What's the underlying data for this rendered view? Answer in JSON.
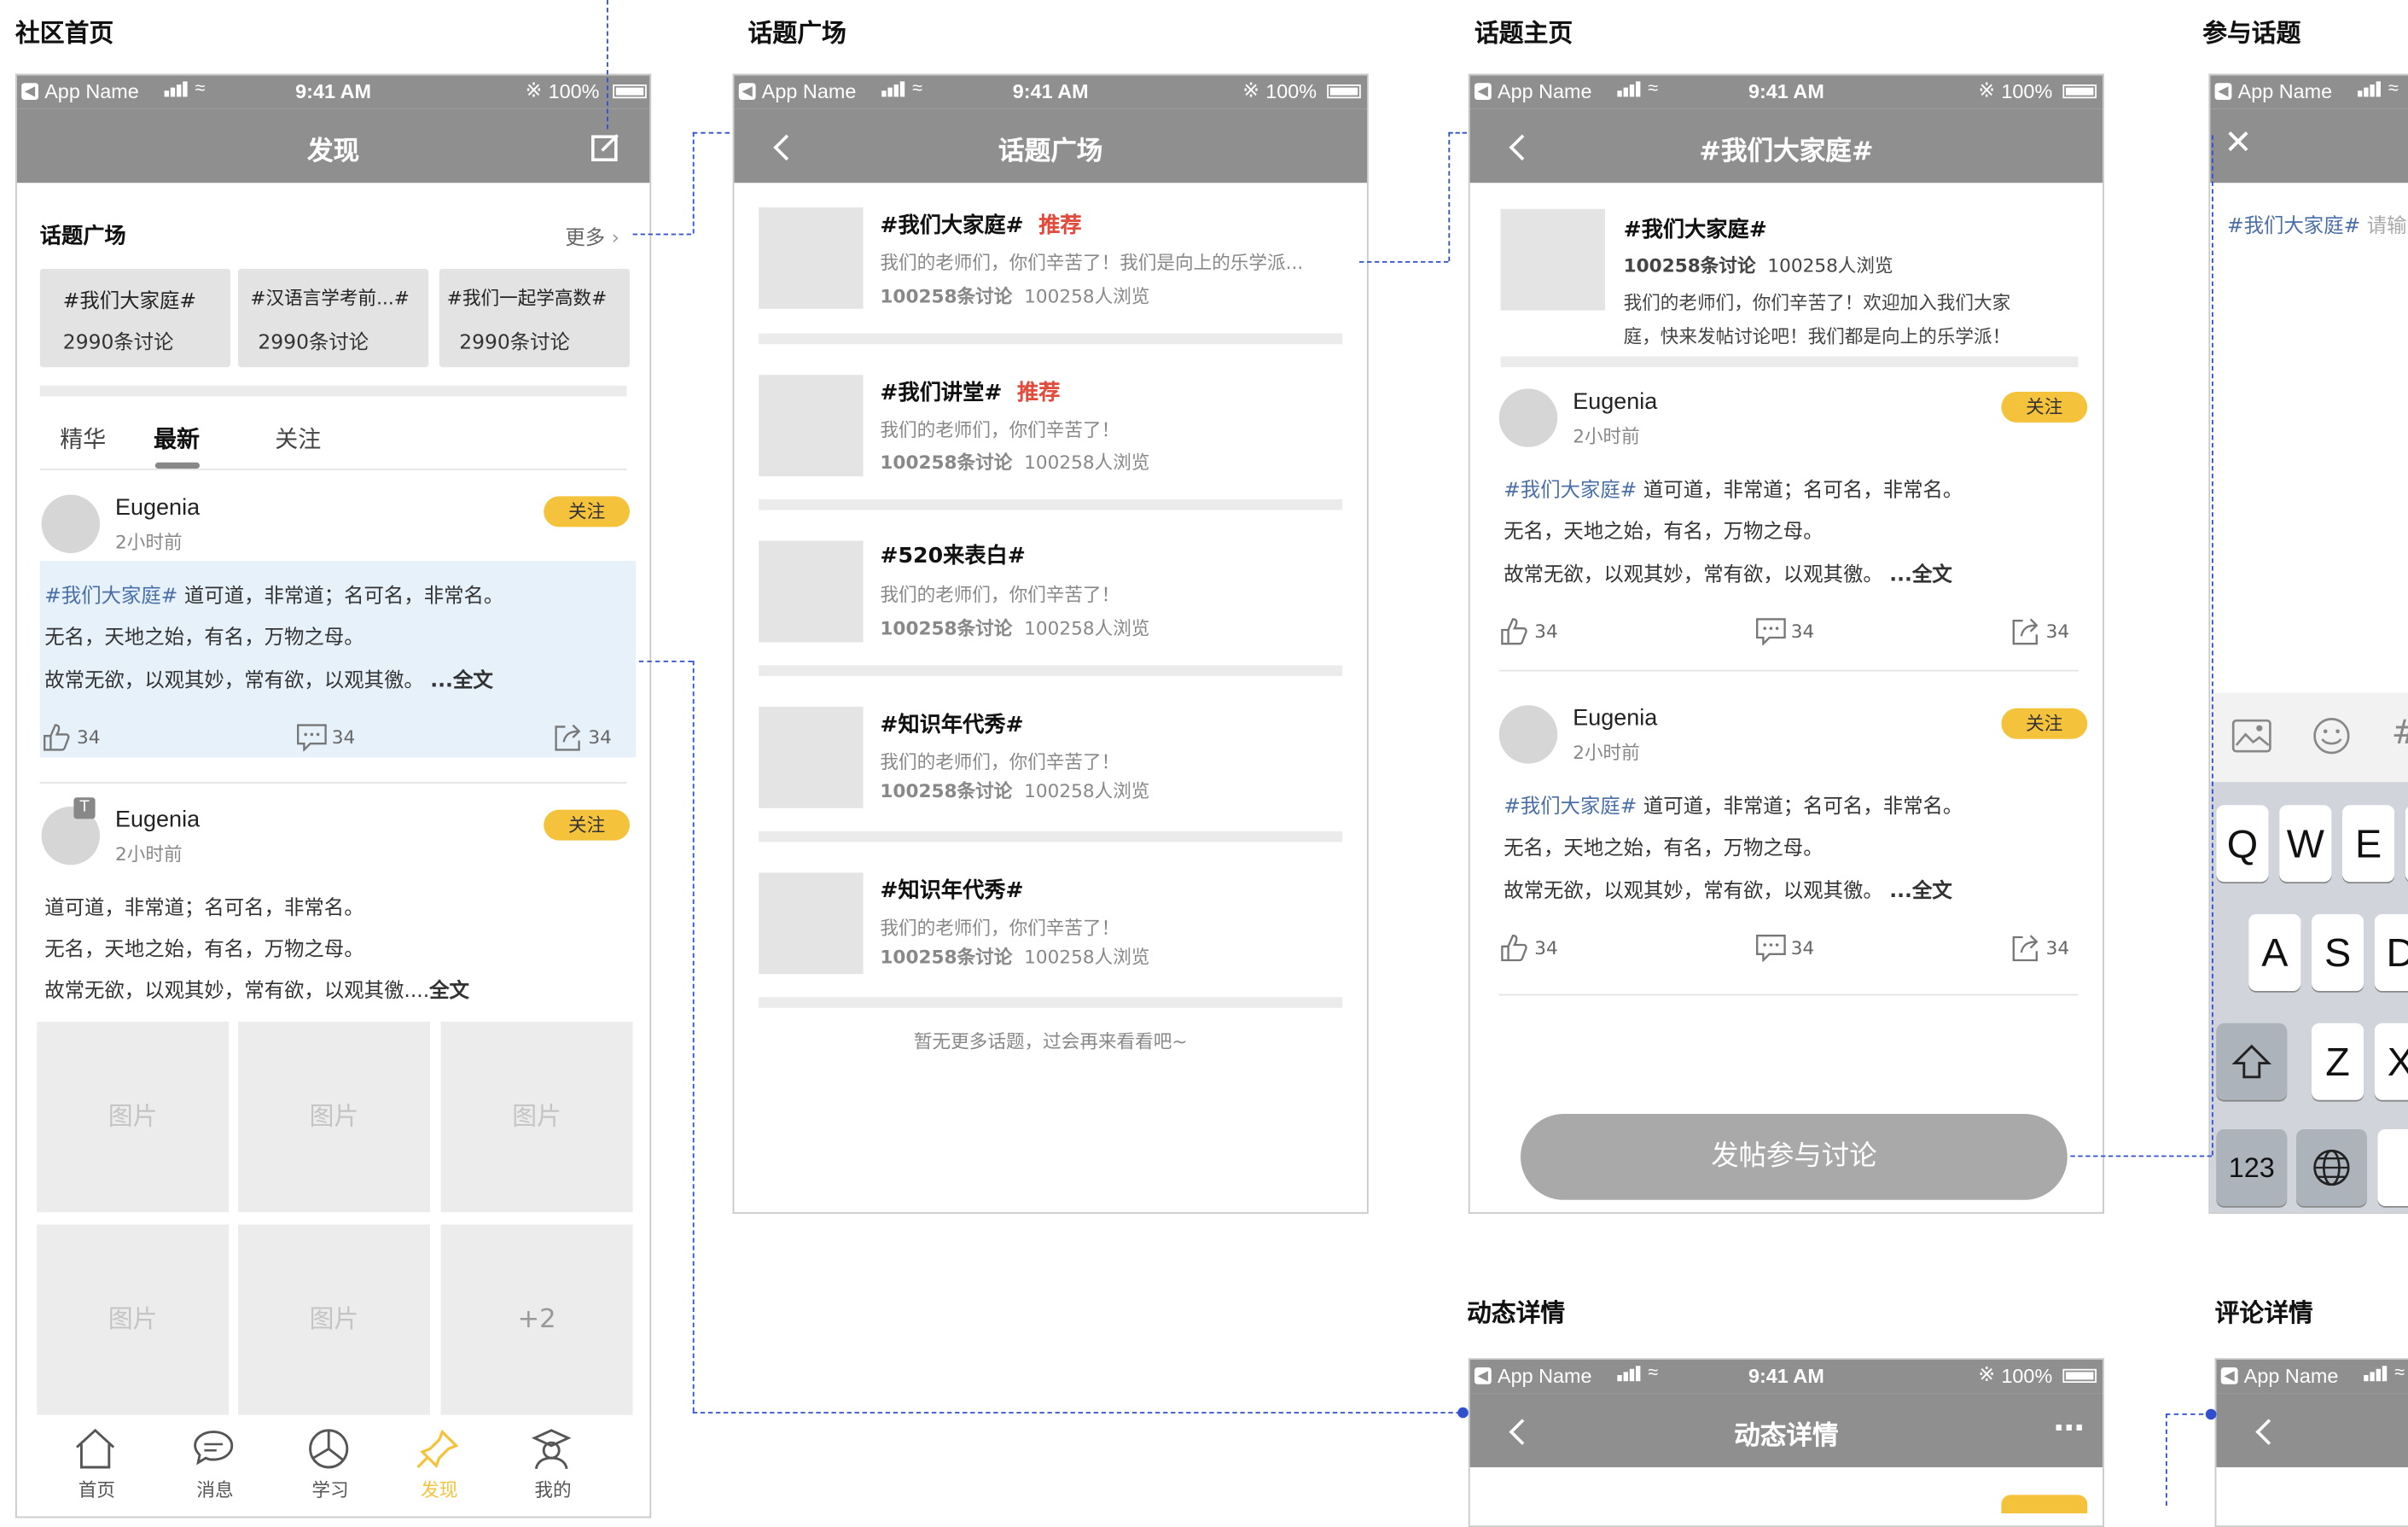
{
  "sections": {
    "home": "社区首页",
    "square": "话题广场",
    "topic_home": "话题主页",
    "join": "参与话题",
    "post_detail": "动态详情",
    "comment_detail": "评论详情"
  },
  "status_bar": {
    "app_name": "App Name",
    "time": "9:41 AM",
    "battery": "100%"
  },
  "home": {
    "nav_title": "发现",
    "topic_square_title": "话题广场",
    "more": "更多",
    "topic_cards": [
      {
        "name": "#我们大家庭#",
        "count": "2990条讨论"
      },
      {
        "name": "#汉语言学考前...#",
        "count": "2990条讨论"
      },
      {
        "name": "#我们一起学高数#",
        "count": "2990条讨论"
      }
    ],
    "tabs": [
      "精华",
      "最新",
      "关注"
    ],
    "active_tab": "最新",
    "post1": {
      "user": "Eugenia",
      "time": "2小时前",
      "follow": "关注",
      "tag": "#我们大家庭#",
      "line1": "道可道，非常道；名可名，非常名。",
      "line2": "无名，天地之始，有名，万物之母。",
      "line3": "故常无欲，以观其妙，常有欲，以观其徼。",
      "full": "...全文",
      "likes": "34",
      "comments": "34",
      "shares": "34"
    },
    "post2": {
      "user": "Eugenia",
      "time": "2小时前",
      "follow": "关注",
      "badge": "T",
      "line1": "道可道，非常道；名可名，非常名。",
      "line2": "无名，天地之始，有名，万物之母。",
      "line3": "故常无欲，以观其妙，常有欲，以观其徼....",
      "full": "全文",
      "images": [
        "图片",
        "图片",
        "图片",
        "图片",
        "图片",
        "+2"
      ]
    },
    "tabbar": [
      "首页",
      "消息",
      "学习",
      "发现",
      "我的"
    ],
    "active_tabbar": "发现"
  },
  "square": {
    "nav_title": "话题广场",
    "items": [
      {
        "name": "#我们大家庭#",
        "badge": "推荐",
        "desc": "我们的老师们，你们辛苦了！我们是向上的乐学派...",
        "discuss": "100258条讨论",
        "views": "100258人浏览"
      },
      {
        "name": "#我们讲堂#",
        "badge": "推荐",
        "desc": "我们的老师们，你们辛苦了！",
        "discuss": "100258条讨论",
        "views": "100258人浏览"
      },
      {
        "name": "#520来表白#",
        "badge": "",
        "desc": "我们的老师们，你们辛苦了！",
        "discuss": "100258条讨论",
        "views": "100258人浏览"
      },
      {
        "name": "#知识年代秀#",
        "badge": "",
        "desc": "我们的老师们，你们辛苦了！",
        "discuss": "100258条讨论",
        "views": "100258人浏览"
      },
      {
        "name": "#知识年代秀#",
        "badge": "",
        "desc": "我们的老师们，你们辛苦了！",
        "discuss": "100258条讨论",
        "views": "100258人浏览"
      }
    ],
    "empty_hint": "暂无更多话题，过会再来看看吧~"
  },
  "topic_home": {
    "nav_title": "#我们大家庭#",
    "name": "#我们大家庭#",
    "discuss": "100258条讨论",
    "views": "100258人浏览",
    "desc1": "我们的老师们，你们辛苦了！欢迎加入我们大家",
    "desc2": "庭，快来发帖讨论吧！我们都是向上的乐学派！",
    "posts": [
      {
        "user": "Eugenia",
        "time": "2小时前",
        "follow": "关注",
        "tag": "#我们大家庭#",
        "line1": "道可道，非常道；名可名，非常名。",
        "line2": "无名，天地之始，有名，万物之母。",
        "line3": "故常无欲，以观其妙，常有欲，以观其徼。",
        "full": "...全文",
        "likes": "34",
        "comments": "34",
        "shares": "34"
      },
      {
        "user": "Eugenia",
        "time": "2小时前",
        "follow": "关注",
        "tag": "#我们大家庭#",
        "line1": "道可道，非常道；名可名，非常名。",
        "line2": "无名，天地之始，有名，万物之母。",
        "line3": "故常无欲，以观其妙，常有欲，以观其徼。",
        "full": "...全文",
        "likes": "34",
        "comments": "34",
        "shares": "34"
      }
    ],
    "post_button": "发帖参与讨论"
  },
  "join": {
    "tag": "#我们大家庭#",
    "placeholder": "请输",
    "keys_row1": [
      "Q",
      "W",
      "E"
    ],
    "keys_row2": [
      "A",
      "S",
      "D"
    ],
    "keys_row3": [
      "Z",
      "X"
    ],
    "key_123": "123"
  },
  "post_detail": {
    "nav_title": "动态详情"
  },
  "colors": {
    "nav_bg": "#8f8f8f",
    "accent": "#f5c33b",
    "badge_red": "#e24a3b",
    "tag_blue": "#4a6ea8",
    "connector": "#2f4fd0"
  }
}
